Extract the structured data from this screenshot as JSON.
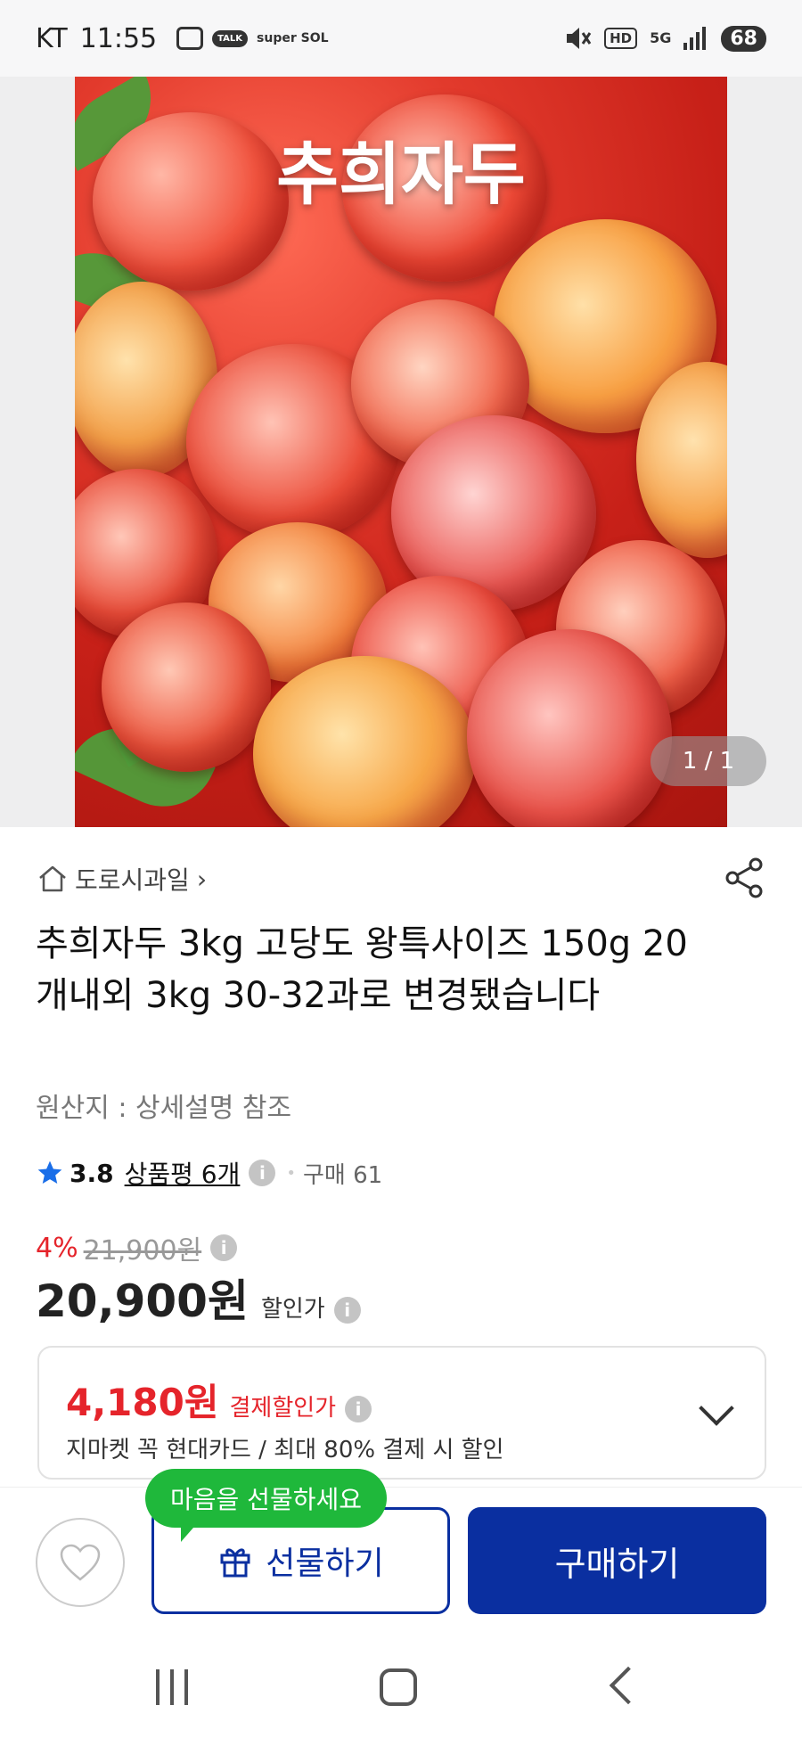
{
  "status_bar": {
    "carrier": "KT",
    "time": "11:55",
    "talk_label": "TALK",
    "sol_label": "super SOL",
    "hd_label": "HD",
    "network_label": "5G",
    "battery": "68"
  },
  "product_image": {
    "title_text": "추희자두",
    "counter": "1 / 1"
  },
  "breadcrumb": {
    "store_name": "도로시과일",
    "arrow": "›"
  },
  "product": {
    "title": "추희자두 3kg 고당도 왕특사이즈 150g 20개내외 3kg 30-32과로 변경됐습니다",
    "origin": "원산지 : 상세설명 참조"
  },
  "rating": {
    "score": "3.8",
    "review_label": "상품평 6개",
    "info": "i",
    "purchase_label": "구매 61"
  },
  "price": {
    "discount_rate": "4%",
    "original_price": "21,900원",
    "sale_price": "20,900원",
    "sale_label": "할인가",
    "info": "i"
  },
  "card_discount": {
    "price": "4,180원",
    "label": "결제할인가",
    "description": "지마켓 꼭 현대카드 / 최대 80% 결제 시 할인"
  },
  "actions": {
    "tooltip": "마음을 선물하세요",
    "gift_label": "선물하기",
    "buy_label": "구매하기"
  },
  "colors": {
    "accent_blue": "#0a2fa0",
    "discount_red": "#e5242b",
    "tooltip_green": "#1fb83b",
    "star": "#1a6ee8"
  }
}
